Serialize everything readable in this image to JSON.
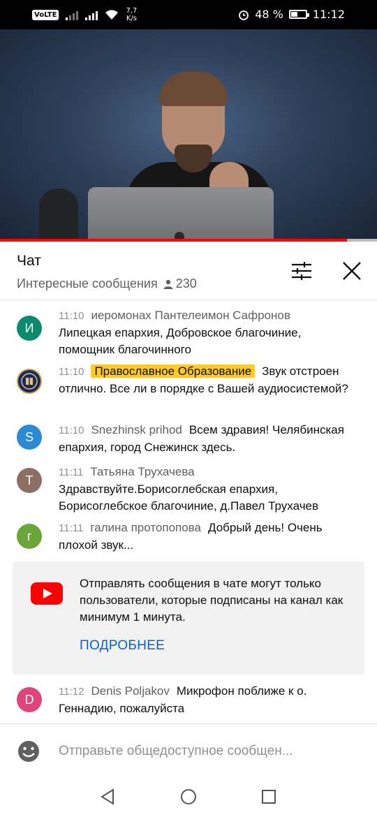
{
  "status_bar": {
    "volte": "VoLTE",
    "net_speed_value": "7,7",
    "net_speed_unit": "K/s",
    "battery": "48 %",
    "battery_level": 0.48,
    "time": "11:12",
    "icons": [
      "volte-icon",
      "signal-icon",
      "signal-icon",
      "wifi-icon",
      "alarm-icon",
      "battery-icon"
    ]
  },
  "video": {
    "progress": 0.92
  },
  "chat": {
    "title": "Чат",
    "mode": "Интересные сообщения",
    "viewers": "230",
    "icons": [
      "person-icon",
      "tune-icon",
      "close-icon"
    ]
  },
  "messages": [
    {
      "time": "11:10",
      "author": "иеромонах Пантелеимон Сафронов",
      "text": "Липецкая епархия, Добровское благочиние, помощник благочинного",
      "avatar_letter": "И",
      "avatar_color": "#0b8a6e"
    },
    {
      "time": "11:10",
      "author": "Православное Образование",
      "text": "Звук отстроен отлично. Все ли в порядке с Вашей аудиосистемой?",
      "avatar_letter": "",
      "avatar_color": "#1b2a5e"
    },
    {
      "time": "11:10",
      "author": "Snezhinsk prihod",
      "text": "Всем здравия! Челябинская епархия, город Снежинск здесь.",
      "avatar_letter": "S",
      "avatar_color": "#2a8ad4"
    },
    {
      "time": "11:11",
      "author": "Татьяна Трухачева",
      "text": "Здравствуйте.Борисоглебская епархия, Борисоглебское благочиние, д.Павел Трухачев",
      "avatar_letter": "Т",
      "avatar_color": "#8d6e63"
    },
    {
      "time": "11:11",
      "author": "галина протопопова",
      "text": "Добрый день! Очень плохой звук...",
      "avatar_letter": "г",
      "avatar_color": "#6aa53a"
    },
    {
      "time": "11:12",
      "author": "Denis Poljakov",
      "text": "Микрофон поближе к о. Геннадию, пожалуйста",
      "avatar_letter": "D",
      "avatar_color": "#e0457a"
    }
  ],
  "notice": {
    "text": "Отправлять сообщения в чате могут только пользователи, которые подписаны на канал как минимум 1 минута.",
    "link": "ПОДРОБНЕЕ",
    "icon": "youtube-icon"
  },
  "input": {
    "placeholder": "Отправьте общедоступное сообщен..."
  },
  "nav": {
    "icons": [
      "back-icon",
      "home-icon",
      "recent-apps-icon"
    ]
  },
  "colors": {
    "progress": "#ff0000",
    "link": "#065fd4",
    "badge": "#ffca28",
    "notice_bg": "#f2f2f2"
  }
}
